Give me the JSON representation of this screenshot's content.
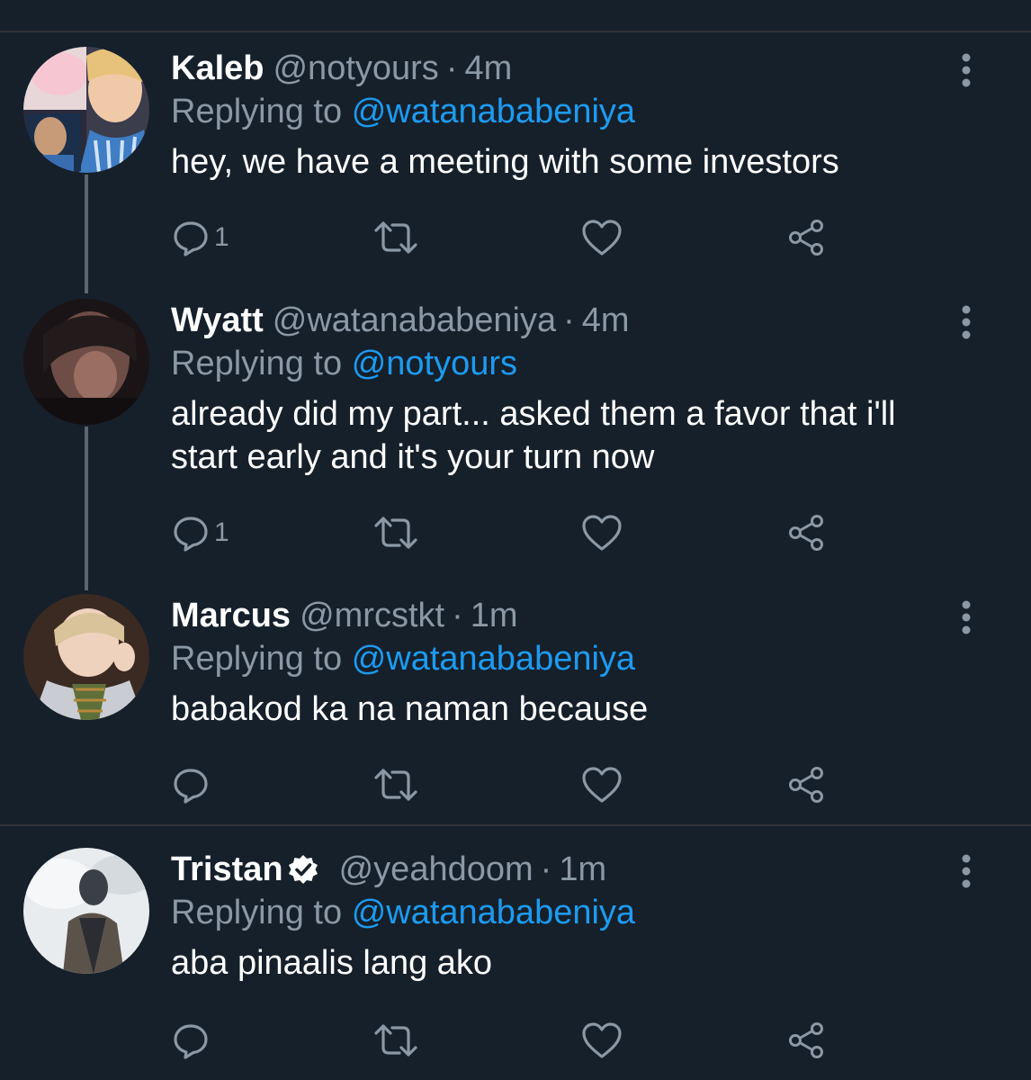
{
  "tweets": [
    {
      "name": "Kaleb",
      "handle": "@notyours",
      "sep": "·",
      "time": "4m",
      "replying_prefix": "Replying to",
      "replying_to": "@watanababeniya",
      "text": "hey, we have a meeting with some investors",
      "reply_count": "1",
      "verified": false
    },
    {
      "name": "Wyatt",
      "handle": "@watanababeniya",
      "sep": "·",
      "time": "4m",
      "replying_prefix": "Replying to",
      "replying_to": "@notyours",
      "text": "already did my part... asked them a favor that i'll start early and it's your turn now",
      "reply_count": "1",
      "verified": false
    },
    {
      "name": "Marcus",
      "handle": "@mrcstkt",
      "sep": "·",
      "time": "1m",
      "replying_prefix": "Replying to",
      "replying_to": "@watanababeniya",
      "text": "babakod ka na naman because",
      "reply_count": "",
      "verified": false
    },
    {
      "name": "Tristan",
      "handle": "@yeahdoom",
      "sep": "·",
      "time": "1m",
      "replying_prefix": "Replying to",
      "replying_to": "@watanababeniya",
      "text": "aba pinaalis lang ako",
      "reply_count": "",
      "verified": true
    }
  ],
  "icons": {
    "reply": "reply-icon",
    "retweet": "retweet-icon",
    "like": "heart-icon",
    "share": "share-icon",
    "more": "more-vertical-icon",
    "verified": "verified-badge-icon"
  },
  "colors": {
    "background": "#15202b",
    "divider": "#2f3336",
    "text_primary": "#ffffff",
    "text_secondary": "#8b98a5",
    "accent": "#1d9bf0"
  }
}
